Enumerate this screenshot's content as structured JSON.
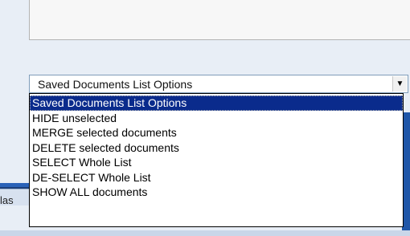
{
  "background": {
    "partial_label": "las"
  },
  "select": {
    "value": "Saved Documents List Options"
  },
  "options": [
    {
      "label": "Saved Documents List Options",
      "selected": true
    },
    {
      "label": "HIDE unselected",
      "selected": false
    },
    {
      "label": "MERGE selected documents",
      "selected": false
    },
    {
      "label": "DELETE selected documents",
      "selected": false
    },
    {
      "label": "SELECT Whole List",
      "selected": false
    },
    {
      "label": "DE-SELECT Whole List",
      "selected": false
    },
    {
      "label": "SHOW ALL documents",
      "selected": false
    }
  ],
  "colors": {
    "highlight": "#0a2b8c",
    "highlight_text": "#ffffff"
  },
  "icons": {
    "dropdown_arrow": "chevron-down-icon"
  }
}
